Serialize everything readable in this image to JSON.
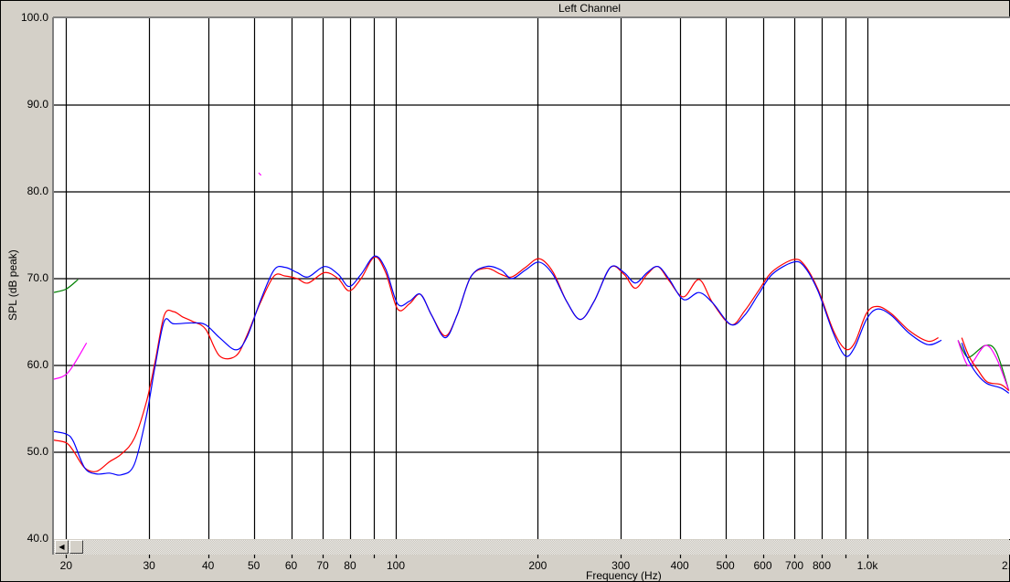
{
  "chart_data": {
    "type": "line",
    "title": "Left Channel",
    "xlabel": "Frequency (Hz)",
    "ylabel": "SPL (dB peak)",
    "xscale": "log",
    "xlim": [
      18.8,
      2000
    ],
    "ylim": [
      40,
      100
    ],
    "grid": true,
    "y_ticks": [
      {
        "v": 100,
        "label": "100.0"
      },
      {
        "v": 90,
        "label": "90.0"
      },
      {
        "v": 80,
        "label": "80.0"
      },
      {
        "v": 70,
        "label": "70.0"
      },
      {
        "v": 60,
        "label": "60.0"
      },
      {
        "v": 50,
        "label": "50.0"
      },
      {
        "v": 40,
        "label": "40.0"
      }
    ],
    "x_gridlines": [
      20,
      30,
      40,
      50,
      60,
      70,
      80,
      90,
      100,
      200,
      300,
      400,
      500,
      600,
      700,
      800,
      900,
      1000
    ],
    "x_ticks": [
      {
        "v": 20,
        "label": "20"
      },
      {
        "v": 30,
        "label": "30"
      },
      {
        "v": 40,
        "label": "40"
      },
      {
        "v": 50,
        "label": "50"
      },
      {
        "v": 60,
        "label": "60"
      },
      {
        "v": 70,
        "label": "70"
      },
      {
        "v": 80,
        "label": "80"
      },
      {
        "v": 100,
        "label": "100"
      },
      {
        "v": 200,
        "label": "200"
      },
      {
        "v": 300,
        "label": "300"
      },
      {
        "v": 400,
        "label": "400"
      },
      {
        "v": 500,
        "label": "500"
      },
      {
        "v": 600,
        "label": "600"
      },
      {
        "v": 700,
        "label": "700"
      },
      {
        "v": 800,
        "label": "800"
      },
      {
        "v": 1000,
        "label": "1.0k"
      },
      {
        "v": 2000,
        "label": "2.0"
      }
    ],
    "series": [
      {
        "name": "green",
        "color": "#008000",
        "segments": [
          [
            [
              18.8,
              68.4
            ],
            [
              20,
              68.8
            ],
            [
              21.2,
              69.9
            ]
          ],
          [
            [
              1556,
              62.9
            ],
            [
              1619,
              61.1
            ],
            [
              1663,
              61.1
            ],
            [
              1778,
              62.3
            ],
            [
              1875,
              61.6
            ],
            [
              1995,
              57.1
            ]
          ]
        ]
      },
      {
        "name": "magenta",
        "color": "#ff00ff",
        "segments": [
          [
            [
              18.8,
              58.4
            ],
            [
              20.2,
              59.2
            ],
            [
              22.1,
              62.6
            ]
          ],
          [
            [
              51.2,
              82.2
            ],
            [
              51.8,
              81.9
            ]
          ],
          [
            [
              1556,
              62.9
            ],
            [
              1619,
              60.3
            ],
            [
              1663,
              60.2
            ],
            [
              1778,
              62.3
            ],
            [
              1875,
              60.9
            ],
            [
              1995,
              57.1
            ]
          ]
        ]
      },
      {
        "name": "red",
        "color": "#ff0000",
        "segments": [
          [
            [
              18.8,
              51.4
            ],
            [
              20,
              51.1
            ],
            [
              20.7,
              50.2
            ],
            [
              21.9,
              48.2
            ],
            [
              23.2,
              47.8
            ],
            [
              24.7,
              48.9
            ],
            [
              26.2,
              49.8
            ],
            [
              27.9,
              51.6
            ],
            [
              29.6,
              55.8
            ],
            [
              30.9,
              60.5
            ],
            [
              32.3,
              65.8
            ],
            [
              33.8,
              66.2
            ],
            [
              35.3,
              65.6
            ],
            [
              37.0,
              65.1
            ],
            [
              39.5,
              64.2
            ],
            [
              42.3,
              61.1
            ],
            [
              45.8,
              61.1
            ],
            [
              48.3,
              63.4
            ],
            [
              51.6,
              67.2
            ],
            [
              55.2,
              70.3
            ],
            [
              58.3,
              70.3
            ],
            [
              61.8,
              70.0
            ],
            [
              65.2,
              69.5
            ],
            [
              70.6,
              70.7
            ],
            [
              75.5,
              70.0
            ],
            [
              79.6,
              68.6
            ],
            [
              84.4,
              70.0
            ],
            [
              90.2,
              72.5
            ],
            [
              95.2,
              70.7
            ],
            [
              100.9,
              66.5
            ],
            [
              106.9,
              67.1
            ],
            [
              112.8,
              68.2
            ],
            [
              119.1,
              65.8
            ],
            [
              127.3,
              63.4
            ],
            [
              134.9,
              65.8
            ],
            [
              144.2,
              70.2
            ],
            [
              155.6,
              71.2
            ],
            [
              167.1,
              70.5
            ],
            [
              176.2,
              70.2
            ],
            [
              188.4,
              71.3
            ],
            [
              201.4,
              72.3
            ],
            [
              215.3,
              70.8
            ],
            [
              230.2,
              67.4
            ],
            [
              246.2,
              65.3
            ],
            [
              263.4,
              67.4
            ],
            [
              285.1,
              71.3
            ],
            [
              304.8,
              70.5
            ],
            [
              322.1,
              68.9
            ],
            [
              341.2,
              70.5
            ],
            [
              359.7,
              71.4
            ],
            [
              379.3,
              69.8
            ],
            [
              407.4,
              67.9
            ],
            [
              439.5,
              69.9
            ],
            [
              469.9,
              67.2
            ],
            [
              514.0,
              64.7
            ],
            [
              549.5,
              66.3
            ],
            [
              587.5,
              68.6
            ],
            [
              628.1,
              70.8
            ],
            [
              696.6,
              72.2
            ],
            [
              734.5,
              71.6
            ],
            [
              785.2,
              68.8
            ],
            [
              847.2,
              64.0
            ],
            [
              897.4,
              61.9
            ],
            [
              939.7,
              62.6
            ],
            [
              995.4,
              66.0
            ],
            [
              1049.5,
              66.8
            ],
            [
              1122.0,
              66.0
            ],
            [
              1227.4,
              64.0
            ],
            [
              1342.8,
              62.8
            ],
            [
              1414,
              63.2
            ]
          ],
          [
            [
              1585,
              63.2
            ],
            [
              1641,
              61.1
            ],
            [
              1714,
              59.5
            ],
            [
              1795,
              58.1
            ],
            [
              1919,
              57.8
            ],
            [
              1995,
              57.1
            ]
          ]
        ]
      },
      {
        "name": "blue",
        "color": "#0000ff",
        "segments": [
          [
            [
              18.8,
              52.4
            ],
            [
              20,
              52.1
            ],
            [
              20.7,
              51.3
            ],
            [
              21.9,
              48.2
            ],
            [
              23.2,
              47.5
            ],
            [
              24.7,
              47.6
            ],
            [
              26.2,
              47.4
            ],
            [
              27.9,
              48.6
            ],
            [
              29.6,
              54.2
            ],
            [
              30.9,
              60.0
            ],
            [
              32.3,
              65.1
            ],
            [
              33.8,
              64.8
            ],
            [
              37.0,
              64.9
            ],
            [
              39.5,
              64.7
            ],
            [
              42.3,
              63.2
            ],
            [
              45.8,
              61.8
            ],
            [
              48.3,
              63.2
            ],
            [
              51.6,
              67.4
            ],
            [
              55.2,
              71.0
            ],
            [
              58.3,
              71.3
            ],
            [
              61.8,
              70.7
            ],
            [
              65.2,
              70.2
            ],
            [
              70.6,
              71.4
            ],
            [
              75.5,
              70.5
            ],
            [
              79.6,
              69.1
            ],
            [
              84.4,
              70.5
            ],
            [
              90.2,
              72.6
            ],
            [
              95.2,
              71.1
            ],
            [
              100.9,
              67.1
            ],
            [
              106.9,
              67.4
            ],
            [
              112.8,
              68.2
            ],
            [
              119.1,
              65.8
            ],
            [
              127.3,
              63.2
            ],
            [
              134.9,
              65.8
            ],
            [
              144.2,
              70.2
            ],
            [
              155.6,
              71.4
            ],
            [
              167.1,
              71.0
            ],
            [
              176.2,
              70.0
            ],
            [
              188.4,
              71.0
            ],
            [
              201.4,
              71.9
            ],
            [
              215.3,
              70.5
            ],
            [
              230.2,
              67.4
            ],
            [
              246.2,
              65.3
            ],
            [
              263.4,
              67.4
            ],
            [
              285.1,
              71.3
            ],
            [
              304.8,
              70.7
            ],
            [
              322.1,
              69.5
            ],
            [
              341.2,
              70.7
            ],
            [
              359.7,
              71.4
            ],
            [
              379.3,
              70.0
            ],
            [
              407.4,
              67.6
            ],
            [
              439.5,
              68.4
            ],
            [
              469.9,
              67.2
            ],
            [
              514.0,
              64.7
            ],
            [
              549.5,
              65.8
            ],
            [
              587.5,
              68.2
            ],
            [
              628.1,
              70.5
            ],
            [
              696.6,
              71.9
            ],
            [
              734.5,
              71.4
            ],
            [
              785.2,
              68.6
            ],
            [
              847.2,
              63.7
            ],
            [
              897.4,
              61.1
            ],
            [
              939.7,
              62.1
            ],
            [
              995.4,
              65.3
            ],
            [
              1049.5,
              66.5
            ],
            [
              1122.0,
              65.8
            ],
            [
              1227.4,
              63.7
            ],
            [
              1342.8,
              62.4
            ],
            [
              1435.5,
              62.9
            ]
          ],
          [
            [
              1585,
              62.6
            ],
            [
              1641,
              60.5
            ],
            [
              1714,
              58.9
            ],
            [
              1795,
              57.9
            ],
            [
              1919,
              57.4
            ],
            [
              1995,
              56.8
            ]
          ]
        ]
      }
    ]
  }
}
